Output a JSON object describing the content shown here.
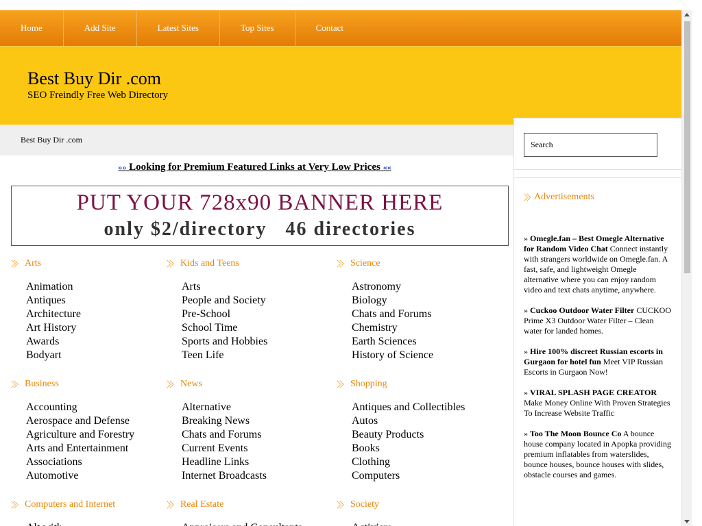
{
  "nav": {
    "items": [
      "Home",
      "Add Site",
      "Latest Sites",
      "Top Sites",
      "Contact"
    ]
  },
  "header": {
    "title": "Best Buy Dir .com",
    "tagline": "SEO Freindly Free Web Directory"
  },
  "breadcrumb": "Best Buy Dir .com",
  "promo": {
    "prefix": "»»",
    "text": "Looking for Premium Featured Links at Very Low Prices",
    "suffix": "««"
  },
  "banner": {
    "line1": "PUT YOUR 728x90 BANNER HERE",
    "line2": "only $2/directory   46 directories"
  },
  "search": {
    "placeholder": "Search"
  },
  "ads": {
    "title": "Advertisements",
    "items": [
      {
        "title": "Omegle.fan – Best Omegle Alternative for Random Video Chat",
        "text": "Connect instantly with strangers worldwide on Omegle.fan. A fast, safe, and lightweight Omegle alternative where you can enjoy random video and text chats anytime, anywhere."
      },
      {
        "title": "Cuckoo Outdoor Water Filter",
        "text": "CUCKOO Prime X3 Outdoor Water Filter – Clean water for landed homes."
      },
      {
        "title": "Hire 100% discreet Russian escorts in Gurgaon for hotel fun",
        "text": "Meet VIP Russian Escorts in Gurgaon Now!"
      },
      {
        "title": "VIRAL SPLASH PAGE CREATOR",
        "text": "Make Money Online With Proven Strategies To Increase Website Traffic"
      },
      {
        "title": "Too The Moon Bounce Co",
        "text": "A bounce house company located in Apopka providing premium inflatables from waterslides, bounce houses, bounce houses with slides, obstacle courses and games."
      }
    ]
  },
  "categories": [
    {
      "title": "Arts",
      "items": [
        "Animation",
        "Antiques",
        "Architecture",
        "Art History",
        "Awards",
        "Bodyart"
      ]
    },
    {
      "title": "Kids and Teens",
      "items": [
        "Arts",
        "People and Society",
        "Pre-School",
        "School Time",
        "Sports and Hobbies",
        "Teen Life"
      ]
    },
    {
      "title": "Science",
      "items": [
        "Astronomy",
        "Biology",
        "Chats and Forums",
        "Chemistry",
        "Earth Sciences",
        "History of Science"
      ]
    },
    {
      "title": "Business",
      "items": [
        "Accounting",
        "Aerospace and Defense",
        "Agriculture and Forestry",
        "Arts and Entertainment",
        "Associations",
        "Automotive"
      ]
    },
    {
      "title": "News",
      "items": [
        "Alternative",
        "Breaking News",
        "Chats and Forums",
        "Current Events",
        "Headline Links",
        "Internet Broadcasts"
      ]
    },
    {
      "title": "Shopping",
      "items": [
        "Antiques and Collectibles",
        "Autos",
        "Beauty Products",
        "Books",
        "Clothing",
        "Computers"
      ]
    },
    {
      "title": "Computers and Internet",
      "items": [
        "Alt.with"
      ]
    },
    {
      "title": "Real Estate",
      "items": [
        "Appraisers and Consultants"
      ]
    },
    {
      "title": "Society",
      "items": [
        "Activism"
      ]
    }
  ]
}
